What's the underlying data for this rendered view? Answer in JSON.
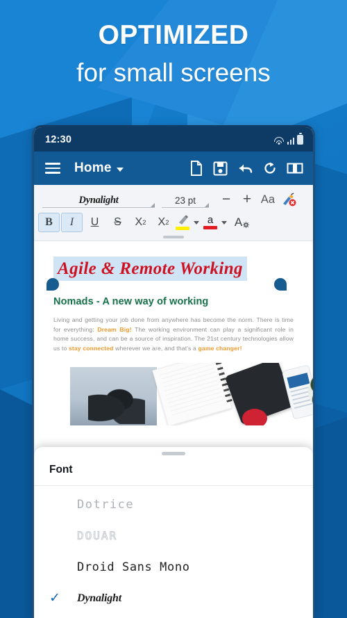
{
  "promo": {
    "headline": "OPTIMIZED",
    "subhead": "for small screens"
  },
  "phone": {
    "status_bar": {
      "time": "12:30",
      "icons": [
        "wifi-icon",
        "signal-icon",
        "battery-icon"
      ]
    },
    "app_bar": {
      "menu_icon": "hamburger-menu-icon",
      "title": "Home",
      "dropdown_icon": "chevron-down-icon",
      "actions": [
        {
          "name": "new-document-icon",
          "label": "New"
        },
        {
          "name": "save-icon",
          "label": "Save"
        },
        {
          "name": "undo-icon",
          "label": "Undo"
        },
        {
          "name": "redo-icon",
          "label": "Redo"
        },
        {
          "name": "reading-mode-icon",
          "label": "Read"
        }
      ]
    },
    "format_toolbar": {
      "font_name": "Dynalight",
      "font_size": "23 pt",
      "decrease_label": "−",
      "increase_label": "+",
      "case_label": "Aa",
      "clear_format_icon": "clear-formatting-icon",
      "buttons": [
        {
          "name": "bold-button",
          "label": "B",
          "active": true
        },
        {
          "name": "italic-button",
          "label": "I",
          "active": true
        },
        {
          "name": "underline-button",
          "label": "U",
          "active": false
        },
        {
          "name": "strikethrough-button",
          "label": "S",
          "active": false
        },
        {
          "name": "subscript-button",
          "label": "X",
          "sub": "2",
          "active": false
        },
        {
          "name": "superscript-button",
          "label": "X",
          "sup": "2",
          "active": false
        }
      ],
      "highlight_color": "#ffef00",
      "text_color": "#e31b23",
      "text_color_label": "a",
      "font_settings_label": "A"
    },
    "document": {
      "title": "Agile & Remote Working",
      "title_color": "#cc1122",
      "title_highlight": "#cfe5f5",
      "subtitle": "Nomads - A new way of working",
      "subtitle_color": "#16704a",
      "paragraph_parts": [
        {
          "text": "Living and getting your job done from anywhere has become the norm. There is time for everything: ",
          "highlight": false
        },
        {
          "text": "Dream Big!",
          "highlight": true
        },
        {
          "text": " The working environment can play a significant role in home success, and can be a source of inspiration. The 21st century technologies allow us to ",
          "highlight": false
        },
        {
          "text": "stay connected",
          "highlight": true
        },
        {
          "text": " wherever we are, and that's a ",
          "highlight": false
        },
        {
          "text": "game changer!",
          "highlight": true
        }
      ],
      "highlight_color": "#f0992e"
    },
    "font_sheet": {
      "title": "Font",
      "items": [
        {
          "label": "Dotrice",
          "style": "fi-dotrice",
          "selected": false
        },
        {
          "label": "DOUAR",
          "style": "fi-douar",
          "selected": false
        },
        {
          "label": "Droid Sans Mono",
          "style": "fi-droid",
          "selected": false
        },
        {
          "label": "Dynalight",
          "style": "fi-dynalight",
          "selected": true
        }
      ],
      "check_glyph": "✓"
    }
  }
}
